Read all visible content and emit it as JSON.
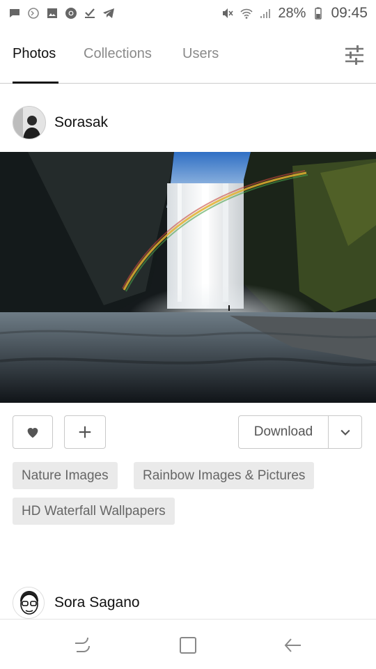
{
  "status_bar": {
    "battery_percent": "28%",
    "time": "09:45",
    "left_icons": [
      "message-icon",
      "notification-icon",
      "gallery-icon",
      "chrome-icon",
      "checkmark-icon",
      "telegram-icon"
    ],
    "right_icons": [
      "mute-icon",
      "wifi-icon",
      "signal-icon",
      "battery-icon"
    ]
  },
  "tabs": [
    {
      "label": "Photos",
      "active": true
    },
    {
      "label": "Collections",
      "active": false
    },
    {
      "label": "Users",
      "active": false
    }
  ],
  "filter_icon": "sliders-icon",
  "post": {
    "author": "Sorasak",
    "photo_alt_icon": "waterfall-photo",
    "download_label": "Download",
    "tags": [
      "Nature Images",
      "Rainbow Images & Pictures",
      "HD Waterfall Wallpapers"
    ]
  },
  "next_post": {
    "author": "Sora Sagano"
  },
  "nav": [
    "recent-apps-icon",
    "home-icon",
    "back-icon"
  ]
}
